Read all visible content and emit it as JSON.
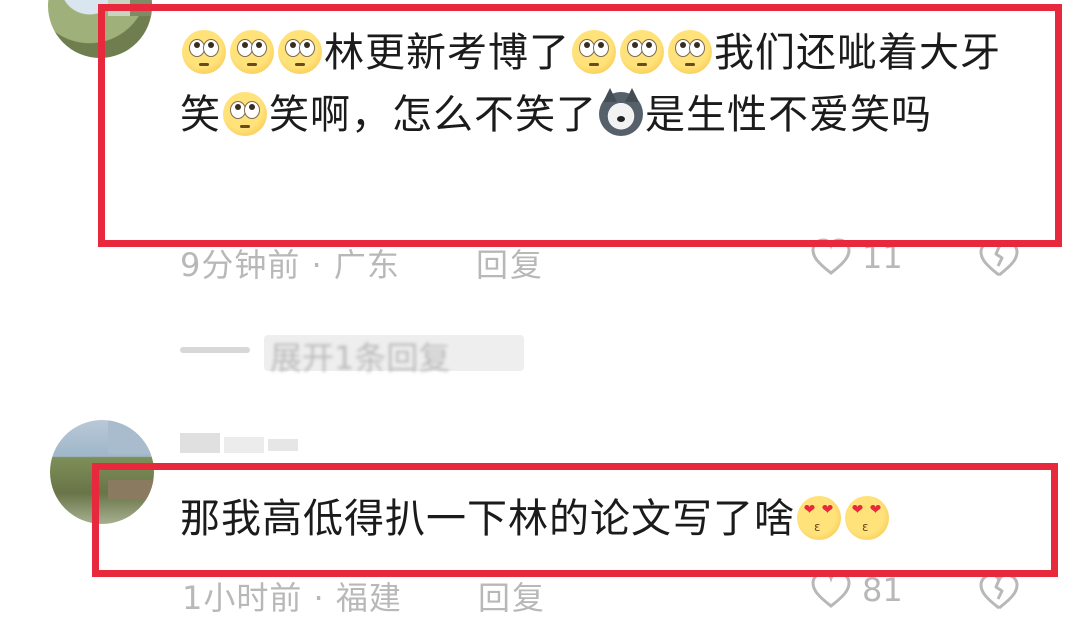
{
  "comments": [
    {
      "segments": [
        {
          "type": "emoji",
          "name": "flushed-face"
        },
        {
          "type": "emoji",
          "name": "flushed-face"
        },
        {
          "type": "emoji",
          "name": "flushed-face"
        },
        {
          "type": "text",
          "value": "林更新考博了"
        },
        {
          "type": "emoji",
          "name": "flushed-face"
        },
        {
          "type": "emoji",
          "name": "flushed-face"
        },
        {
          "type": "emoji",
          "name": "flushed-face"
        },
        {
          "type": "text",
          "value": "我们还呲着大牙笑"
        },
        {
          "type": "emoji",
          "name": "flushed-face"
        },
        {
          "type": "text",
          "value": "笑啊，怎么不笑了"
        },
        {
          "type": "emoji",
          "name": "husky-dog"
        },
        {
          "type": "text",
          "value": "是生性不爱笑吗"
        }
      ],
      "meta": "9分钟前 · 广东",
      "reply_label": "回复",
      "likes": "11"
    },
    {
      "segments": [
        {
          "type": "text",
          "value": "那我高低得扒一下林的论文写了啥"
        },
        {
          "type": "emoji",
          "name": "heart-eyes-kiss"
        },
        {
          "type": "emoji",
          "name": "heart-eyes-kiss"
        }
      ],
      "meta": "1小时前 · 福建",
      "reply_label": "回复",
      "likes": "81"
    }
  ],
  "collapsed_replies_label": "展开1条回复",
  "colors": {
    "highlight": "#e8283c",
    "meta_gray": "#b8b8b8",
    "text": "#1b1b1b"
  },
  "icons": {
    "like": "heart-outline-icon",
    "dislike": "broken-heart-icon"
  }
}
